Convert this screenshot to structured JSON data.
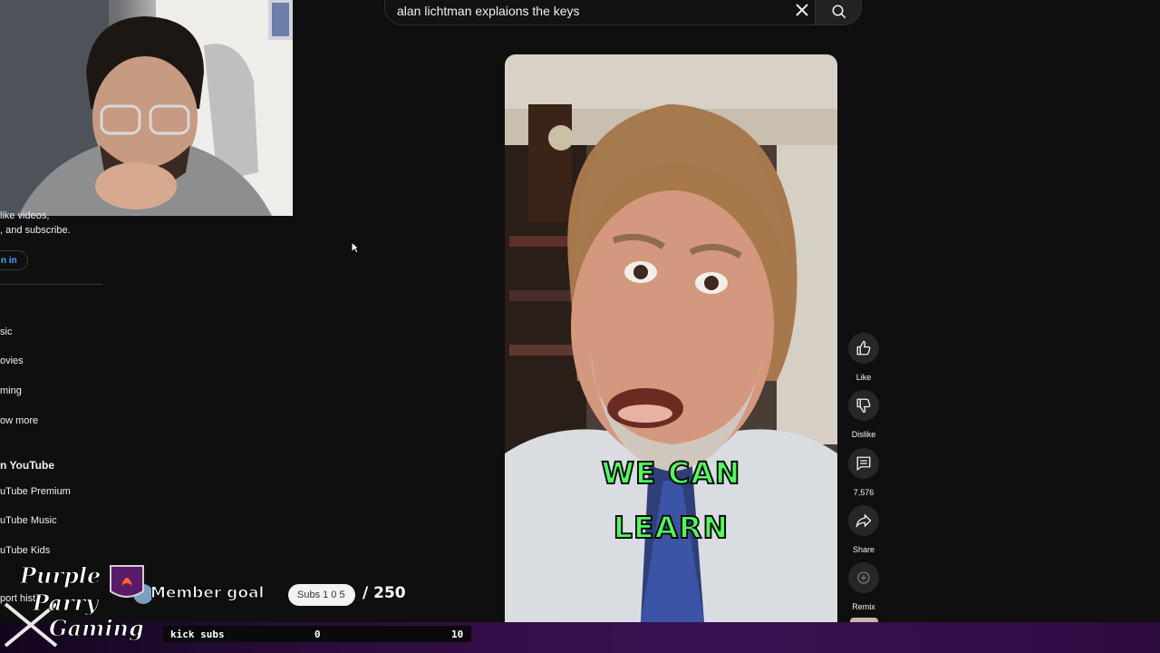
{
  "search": {
    "query": "alan lichtman explaions the keys"
  },
  "sidebar": {
    "signin_prompt_line1": "like videos,",
    "signin_prompt_line2": ", and subscribe.",
    "signin_label": "n in",
    "explore_items": [
      {
        "label": "sic",
        "icon": "music-icon"
      },
      {
        "label": "ovies",
        "icon": "movies-icon"
      },
      {
        "label": "ming",
        "icon": "gaming-icon"
      },
      {
        "label": "ow more",
        "icon": "chevron-down-icon"
      }
    ],
    "more_heading": "n YouTube",
    "more_items": [
      {
        "label": "uTube Premium"
      },
      {
        "label": "uTube Music"
      },
      {
        "label": "uTube Kids"
      },
      {
        "label": "port hist"
      }
    ]
  },
  "video": {
    "caption_line1": "WE CAN",
    "caption_line2": "LEARN"
  },
  "actions": {
    "like_label": "Like",
    "dislike_label": "Dislike",
    "comments_count": "7,576",
    "share_label": "Share",
    "remix_label": "Remix"
  },
  "overlay": {
    "logo_line1": "Purple",
    "logo_line2": "Parry",
    "logo_line3": "Gaming",
    "member_goal_label": "Member goal",
    "subs_chip": "Subs 1 0 5",
    "goal_total": "/ 250",
    "kick_label": "kick subs",
    "kick_current": "0",
    "kick_target": "10"
  },
  "colors": {
    "caption_green": "#4dff58",
    "accent_blue": "#3ea6ff",
    "overlay_purple": "#3a1152"
  }
}
